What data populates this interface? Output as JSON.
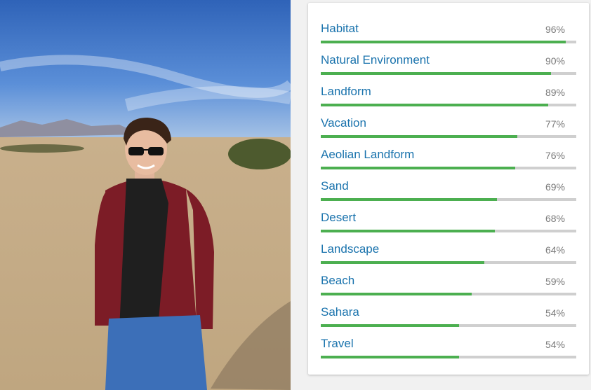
{
  "photo": {
    "description_icon": "photo-image",
    "colors": {
      "sky": "#3f73c4",
      "sand": "#cdb493",
      "sweater": "#7c1c26",
      "scarf": "#1f1f1f",
      "jeans": "#3c6fb8"
    }
  },
  "labels_panel": {
    "accent_color": "#4caf50",
    "label_color": "#1a73ad",
    "items": [
      {
        "label": "Habitat",
        "percent": "96%",
        "score": 0.96
      },
      {
        "label": "Natural Environment",
        "percent": "90%",
        "score": 0.9
      },
      {
        "label": "Landform",
        "percent": "89%",
        "score": 0.89
      },
      {
        "label": "Vacation",
        "percent": "77%",
        "score": 0.77
      },
      {
        "label": "Aeolian Landform",
        "percent": "76%",
        "score": 0.76
      },
      {
        "label": "Sand",
        "percent": "69%",
        "score": 0.69
      },
      {
        "label": "Desert",
        "percent": "68%",
        "score": 0.68
      },
      {
        "label": "Landscape",
        "percent": "64%",
        "score": 0.64
      },
      {
        "label": "Beach",
        "percent": "59%",
        "score": 0.59
      },
      {
        "label": "Sahara",
        "percent": "54%",
        "score": 0.54
      },
      {
        "label": "Travel",
        "percent": "54%",
        "score": 0.54
      }
    ]
  }
}
